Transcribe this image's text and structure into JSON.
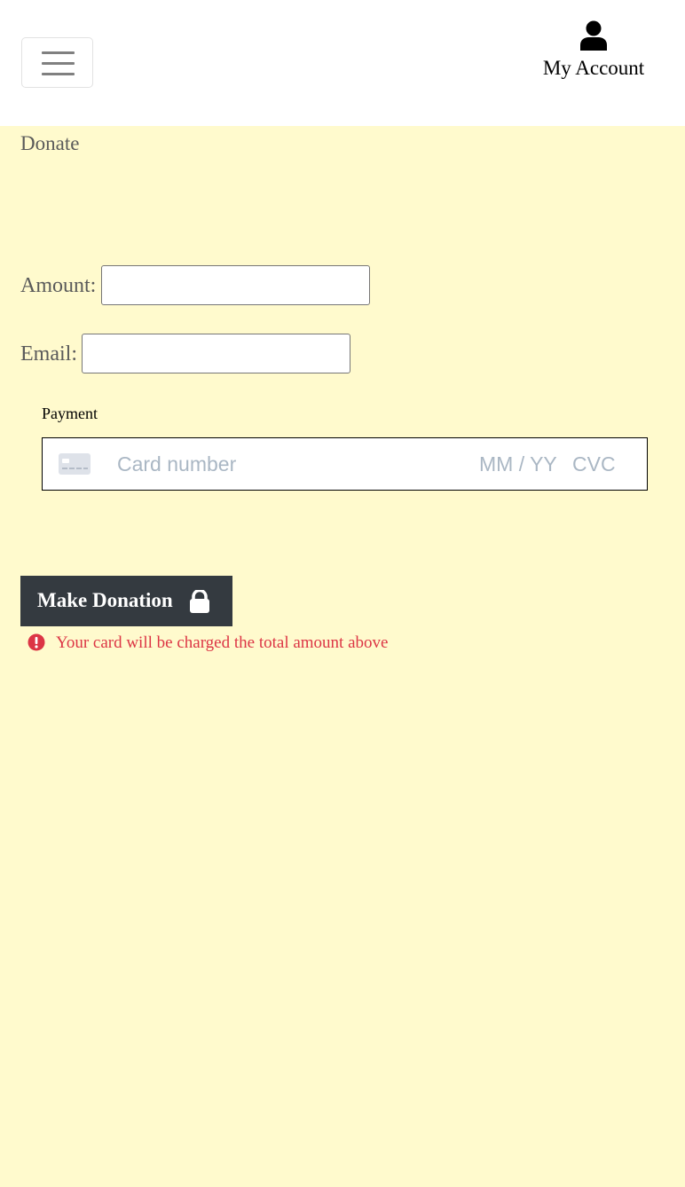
{
  "header": {
    "menu_icon": "hamburger-menu-icon",
    "account_icon": "user-icon",
    "account_label": "My Account"
  },
  "page": {
    "title": "Donate"
  },
  "form": {
    "amount_label": "Amount:",
    "amount_value": "",
    "email_label": "Email:",
    "email_value": "",
    "payment_label": "Payment",
    "card": {
      "icon": "credit-card-icon",
      "number_placeholder": "Card number",
      "expiry_placeholder": "MM / YY",
      "cvc_placeholder": "CVC"
    },
    "submit_label": "Make Donation",
    "submit_icon": "lock-icon",
    "notice_icon": "exclamation-circle-icon",
    "notice_text": "Your card will be charged the total amount above"
  },
  "colors": {
    "page_background": "#fffacd",
    "header_background": "#ffffff",
    "button_background": "#343a40",
    "notice_color": "#dc3545",
    "placeholder_color": "#aab7c4"
  }
}
